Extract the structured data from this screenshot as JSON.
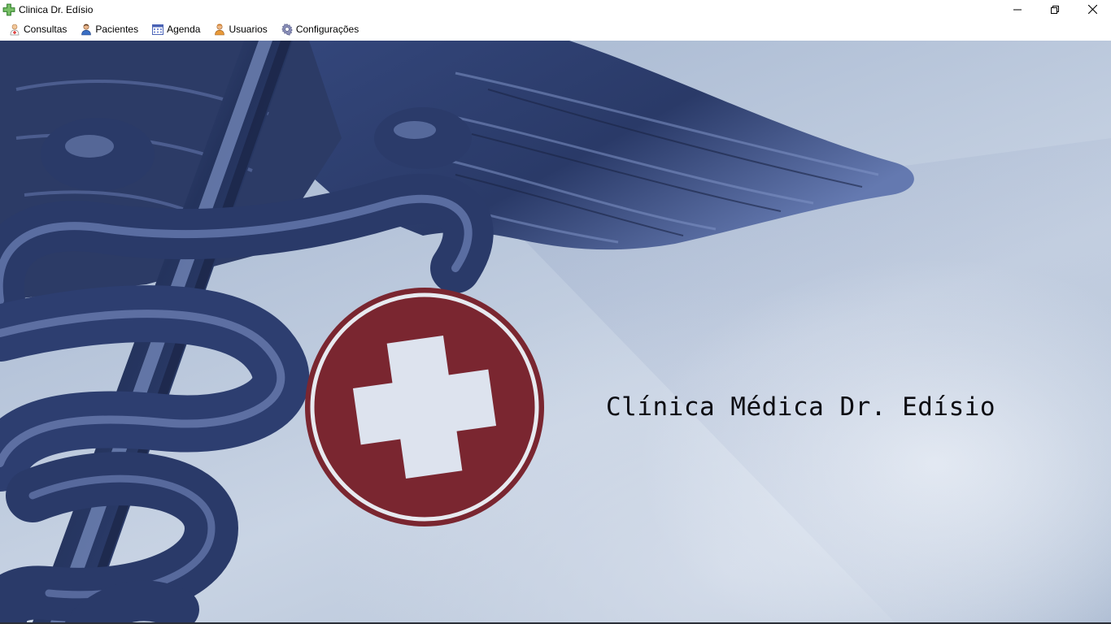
{
  "window": {
    "title": "Clinica Dr. Edísio",
    "app_icon": "green-cross-icon",
    "controls": [
      "minimize-icon",
      "restore-icon",
      "close-icon"
    ]
  },
  "menu": {
    "items": [
      {
        "label": "Consultas",
        "icon": "doctor-icon"
      },
      {
        "label": "Pacientes",
        "icon": "person-icon"
      },
      {
        "label": "Agenda",
        "icon": "calendar-icon"
      },
      {
        "label": "Usuarios",
        "icon": "user-icon"
      },
      {
        "label": "Configurações",
        "icon": "gear-icon"
      }
    ]
  },
  "content": {
    "background_image": "caduceus-with-red-cross-emblem",
    "heading": "Clínica Médica Dr. Edísio"
  },
  "colors": {
    "accent_red": "#7a2630",
    "background_blue": "#b7c5da",
    "metal_blue": "#2d3f6e"
  }
}
